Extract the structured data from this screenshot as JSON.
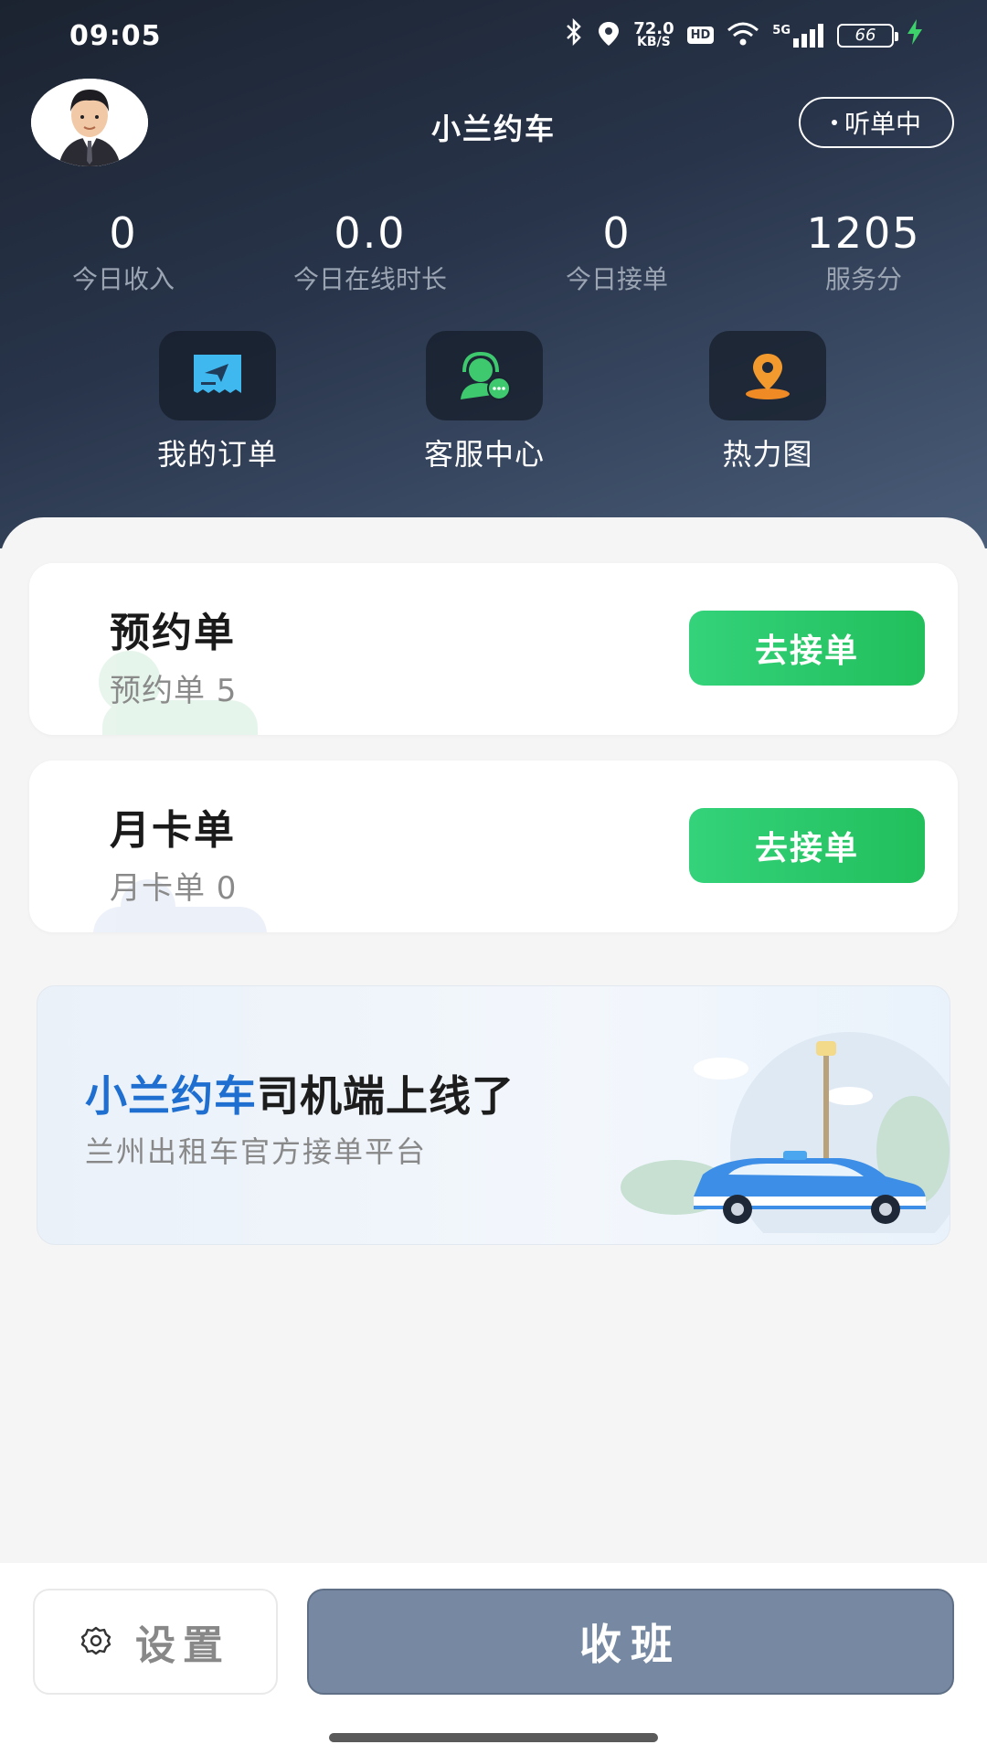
{
  "status_bar": {
    "time": "09:05",
    "net_speed_value": "72.0",
    "net_speed_unit": "KB/S",
    "hd": "HD",
    "signal": "5G",
    "battery": "66"
  },
  "header": {
    "title": "小兰约车",
    "listen_status": "听单中"
  },
  "stats": [
    {
      "value": "0",
      "label": "今日收入"
    },
    {
      "value": "0.0",
      "label": "今日在线时长"
    },
    {
      "value": "0",
      "label": "今日接单"
    },
    {
      "value": "1205",
      "label": "服务分"
    }
  ],
  "quick_actions": [
    {
      "label": "我的订单",
      "icon": "orders-icon"
    },
    {
      "label": "客服中心",
      "icon": "customer-service-icon"
    },
    {
      "label": "热力图",
      "icon": "map-pin-icon"
    }
  ],
  "cards": [
    {
      "title": "预约单",
      "subtitle": "预约单 5",
      "button": "去接单"
    },
    {
      "title": "月卡单",
      "subtitle": "月卡单 0",
      "button": "去接单"
    }
  ],
  "banner": {
    "brand": "小兰约车",
    "headline": "司机端上线了",
    "subtitle": "兰州出租车官方接单平台"
  },
  "bottom": {
    "settings_label": "设置",
    "offduty_label": "收班"
  },
  "colors": {
    "accent_green": "#22bf5c",
    "brand_blue": "#1f6fd1",
    "offduty_gray": "#7789a2",
    "header_dark": "#1b2330"
  }
}
